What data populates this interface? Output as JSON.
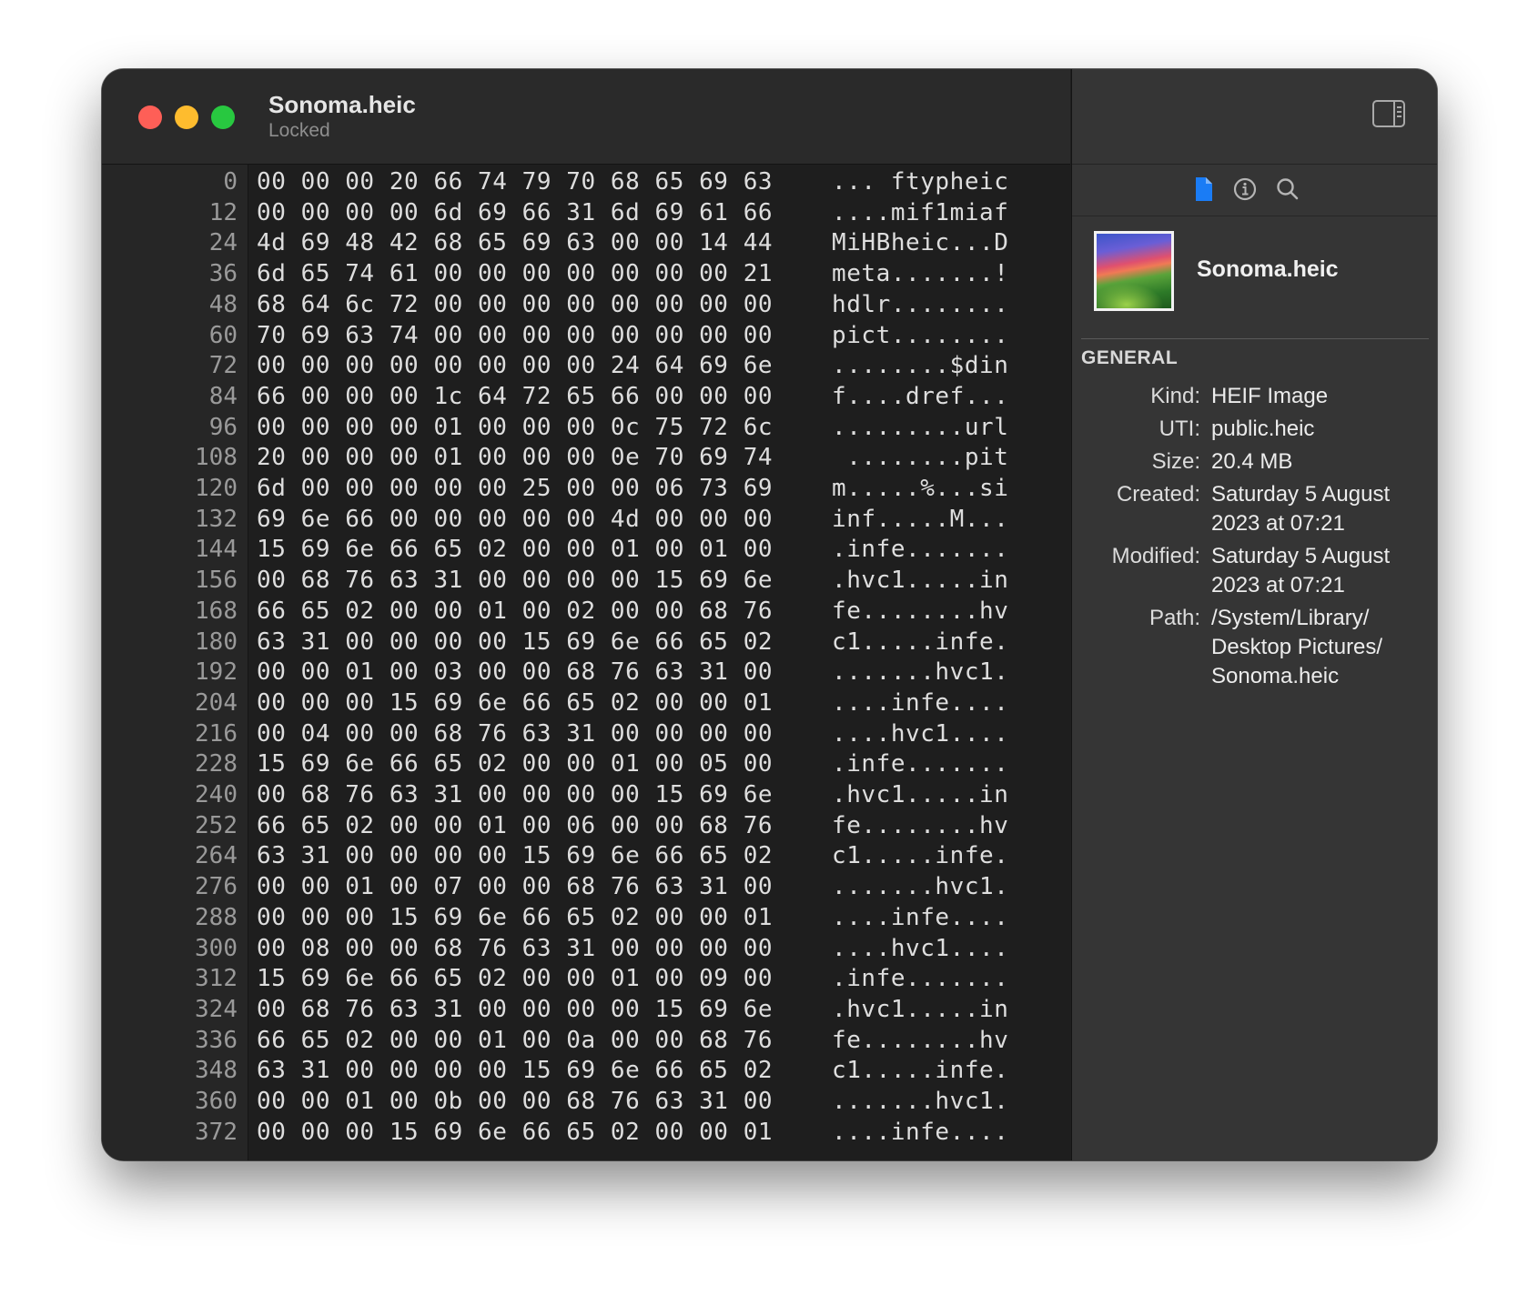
{
  "window": {
    "title": "Sonoma.heic",
    "subtitle": "Locked"
  },
  "hex_rows": [
    {
      "offset": "0",
      "hex": "00 00 00 20 66 74 79 70 68 65 69 63",
      "ascii": "... ftypheic"
    },
    {
      "offset": "12",
      "hex": "00 00 00 00 6d 69 66 31 6d 69 61 66",
      "ascii": "....mif1miaf"
    },
    {
      "offset": "24",
      "hex": "4d 69 48 42 68 65 69 63 00 00 14 44",
      "ascii": "MiHBheic...D"
    },
    {
      "offset": "36",
      "hex": "6d 65 74 61 00 00 00 00 00 00 00 21",
      "ascii": "meta.......!"
    },
    {
      "offset": "48",
      "hex": "68 64 6c 72 00 00 00 00 00 00 00 00",
      "ascii": "hdlr........"
    },
    {
      "offset": "60",
      "hex": "70 69 63 74 00 00 00 00 00 00 00 00",
      "ascii": "pict........"
    },
    {
      "offset": "72",
      "hex": "00 00 00 00 00 00 00 00 24 64 69 6e",
      "ascii": "........$din"
    },
    {
      "offset": "84",
      "hex": "66 00 00 00 1c 64 72 65 66 00 00 00",
      "ascii": "f....dref..."
    },
    {
      "offset": "96",
      "hex": "00 00 00 00 01 00 00 00 0c 75 72 6c",
      "ascii": ".........url"
    },
    {
      "offset": "108",
      "hex": "20 00 00 00 01 00 00 00 0e 70 69 74",
      "ascii": " ........pit"
    },
    {
      "offset": "120",
      "hex": "6d 00 00 00 00 00 25 00 00 06 73 69",
      "ascii": "m.....%...si"
    },
    {
      "offset": "132",
      "hex": "69 6e 66 00 00 00 00 00 4d 00 00 00",
      "ascii": "inf.....M..."
    },
    {
      "offset": "144",
      "hex": "15 69 6e 66 65 02 00 00 01 00 01 00",
      "ascii": ".infe......."
    },
    {
      "offset": "156",
      "hex": "00 68 76 63 31 00 00 00 00 15 69 6e",
      "ascii": ".hvc1.....in"
    },
    {
      "offset": "168",
      "hex": "66 65 02 00 00 01 00 02 00 00 68 76",
      "ascii": "fe........hv"
    },
    {
      "offset": "180",
      "hex": "63 31 00 00 00 00 15 69 6e 66 65 02",
      "ascii": "c1.....infe."
    },
    {
      "offset": "192",
      "hex": "00 00 01 00 03 00 00 68 76 63 31 00",
      "ascii": ".......hvc1."
    },
    {
      "offset": "204",
      "hex": "00 00 00 15 69 6e 66 65 02 00 00 01",
      "ascii": "....infe...."
    },
    {
      "offset": "216",
      "hex": "00 04 00 00 68 76 63 31 00 00 00 00",
      "ascii": "....hvc1...."
    },
    {
      "offset": "228",
      "hex": "15 69 6e 66 65 02 00 00 01 00 05 00",
      "ascii": ".infe......."
    },
    {
      "offset": "240",
      "hex": "00 68 76 63 31 00 00 00 00 15 69 6e",
      "ascii": ".hvc1.....in"
    },
    {
      "offset": "252",
      "hex": "66 65 02 00 00 01 00 06 00 00 68 76",
      "ascii": "fe........hv"
    },
    {
      "offset": "264",
      "hex": "63 31 00 00 00 00 15 69 6e 66 65 02",
      "ascii": "c1.....infe."
    },
    {
      "offset": "276",
      "hex": "00 00 01 00 07 00 00 68 76 63 31 00",
      "ascii": ".......hvc1."
    },
    {
      "offset": "288",
      "hex": "00 00 00 15 69 6e 66 65 02 00 00 01",
      "ascii": "....infe...."
    },
    {
      "offset": "300",
      "hex": "00 08 00 00 68 76 63 31 00 00 00 00",
      "ascii": "....hvc1...."
    },
    {
      "offset": "312",
      "hex": "15 69 6e 66 65 02 00 00 01 00 09 00",
      "ascii": ".infe......."
    },
    {
      "offset": "324",
      "hex": "00 68 76 63 31 00 00 00 00 15 69 6e",
      "ascii": ".hvc1.....in"
    },
    {
      "offset": "336",
      "hex": "66 65 02 00 00 01 00 0a 00 00 68 76",
      "ascii": "fe........hv"
    },
    {
      "offset": "348",
      "hex": "63 31 00 00 00 00 15 69 6e 66 65 02",
      "ascii": "c1.....infe."
    },
    {
      "offset": "360",
      "hex": "00 00 01 00 0b 00 00 68 76 63 31 00",
      "ascii": ".......hvc1."
    },
    {
      "offset": "372",
      "hex": "00 00 00 15 69 6e 66 65 02 00 00 01",
      "ascii": "....infe...."
    }
  ],
  "inspector": {
    "tabs": [
      {
        "icon": "document-icon",
        "active": true
      },
      {
        "icon": "info-icon",
        "active": false
      },
      {
        "icon": "search-icon",
        "active": false
      }
    ],
    "file_name": "Sonoma.heic",
    "section_title": "GENERAL",
    "properties": [
      {
        "label": "Kind:",
        "value": "HEIF Image"
      },
      {
        "label": "UTI:",
        "value": "public.heic"
      },
      {
        "label": "Size:",
        "value": "20.4 MB"
      },
      {
        "label": "Created:",
        "value": "Saturday 5 August 2023 at 07:21"
      },
      {
        "label": "Modified:",
        "value": "Saturday 5 August 2023 at 07:21"
      },
      {
        "label": "Path:",
        "value": "/System/Library/ Desktop Pictures/ Sonoma.heic"
      }
    ]
  },
  "colors": {
    "accent": "#1a7cf5",
    "close": "#fe5f57",
    "minimize": "#febc2e",
    "zoom": "#28c840"
  }
}
